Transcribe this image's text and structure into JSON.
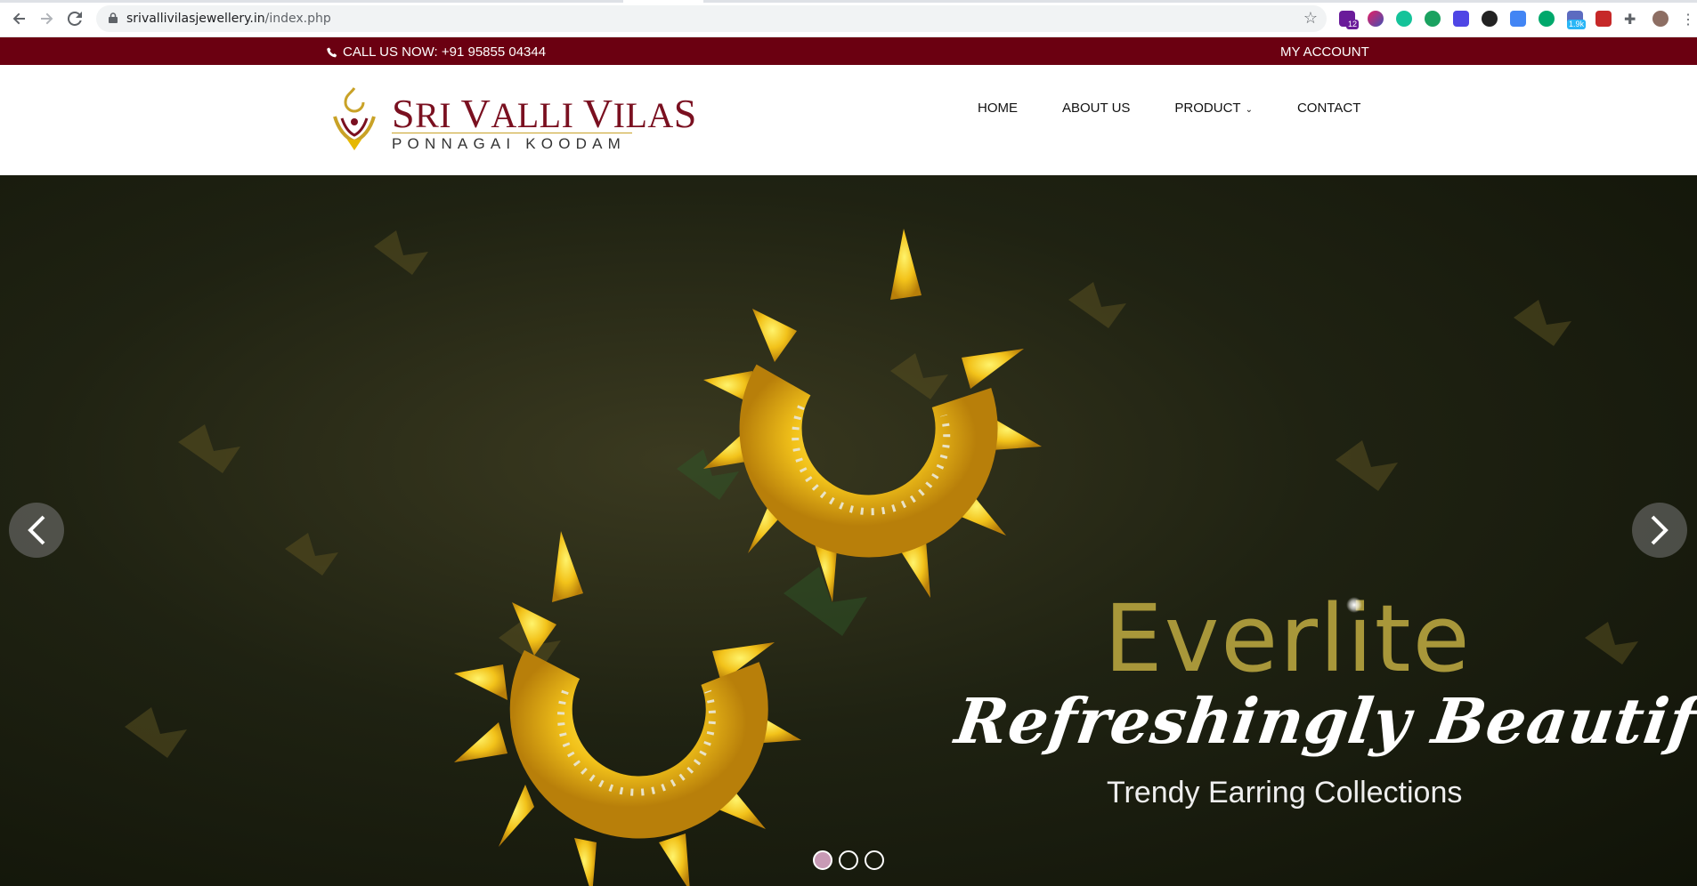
{
  "browser": {
    "url_host": "srivallivilasjewellery.in",
    "url_path": "/index.php",
    "badges": [
      "12",
      "1.9k"
    ]
  },
  "topbar": {
    "call_text": "CALL US NOW: +91 95855 04344",
    "account_label": "MY ACCOUNT"
  },
  "logo": {
    "brand_s": "S",
    "brand_ri": "RI ",
    "brand_v1": "V",
    "brand_alli": "ALLI ",
    "brand_v2": "V",
    "brand_ilas": "ILA",
    "brand_end": "S",
    "tagline": "PONNAGAI KOODAM"
  },
  "menu": {
    "home": "HOME",
    "about": "ABOUT US",
    "product": "PRODUCT",
    "contact": "CONTACT"
  },
  "hero": {
    "brand": "Everlite",
    "slogan": "Refreshingly Beautiful",
    "subtitle": "Trendy Earring Collections",
    "slide_count": 3,
    "active_slide": 1
  },
  "colors": {
    "topbar_bg": "#6b0011",
    "brand_red": "#7a1020",
    "gold": "#c9a227"
  }
}
